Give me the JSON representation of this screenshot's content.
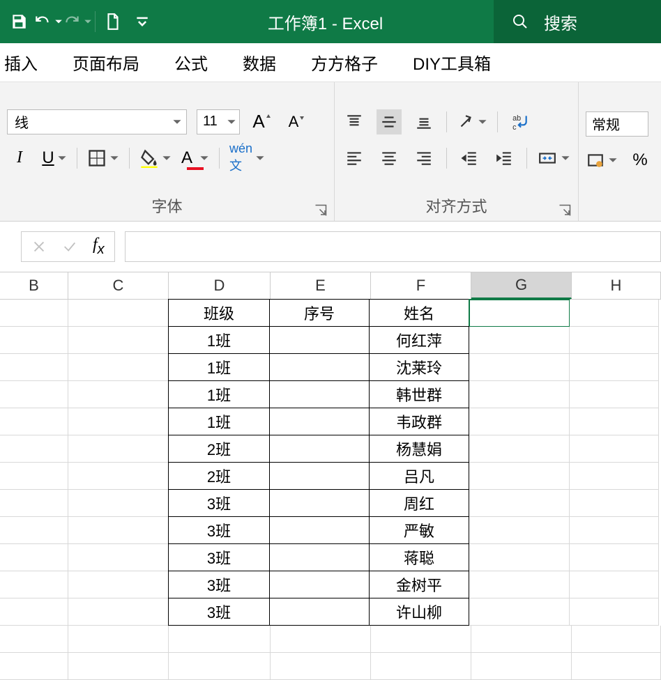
{
  "title": {
    "doc": "工作簿1",
    "sep": " - ",
    "app": "Excel"
  },
  "search": {
    "placeholder": "搜索"
  },
  "tabs": [
    "插入",
    "页面布局",
    "公式",
    "数据",
    "方方格子",
    "DIY工具箱"
  ],
  "font": {
    "name": "线",
    "size": "11"
  },
  "groups": {
    "font": "字体",
    "alignment": "对齐方式"
  },
  "numfmt": "常规",
  "colheads": [
    "B",
    "C",
    "D",
    "E",
    "F",
    "G",
    "H"
  ],
  "selectedCol": "G",
  "tableRange": {
    "cols": [
      "D",
      "E",
      "F"
    ],
    "startRow": 0,
    "endRow": 11
  },
  "cells": [
    {
      "D": "班级",
      "E": "序号",
      "F": "姓名"
    },
    {
      "D": "1班",
      "E": "",
      "F": "何红萍"
    },
    {
      "D": "1班",
      "E": "",
      "F": "沈莱玲"
    },
    {
      "D": "1班",
      "E": "",
      "F": "韩世群"
    },
    {
      "D": "1班",
      "E": "",
      "F": "韦政群"
    },
    {
      "D": "2班",
      "E": "",
      "F": "杨慧娟"
    },
    {
      "D": "2班",
      "E": "",
      "F": "吕凡"
    },
    {
      "D": "3班",
      "E": "",
      "F": "周红"
    },
    {
      "D": "3班",
      "E": "",
      "F": "严敏"
    },
    {
      "D": "3班",
      "E": "",
      "F": "蒋聪"
    },
    {
      "D": "3班",
      "E": "",
      "F": "金树平"
    },
    {
      "D": "3班",
      "E": "",
      "F": "许山柳"
    },
    {
      "D": "",
      "E": "",
      "F": ""
    },
    {
      "D": "",
      "E": "",
      "F": ""
    }
  ]
}
